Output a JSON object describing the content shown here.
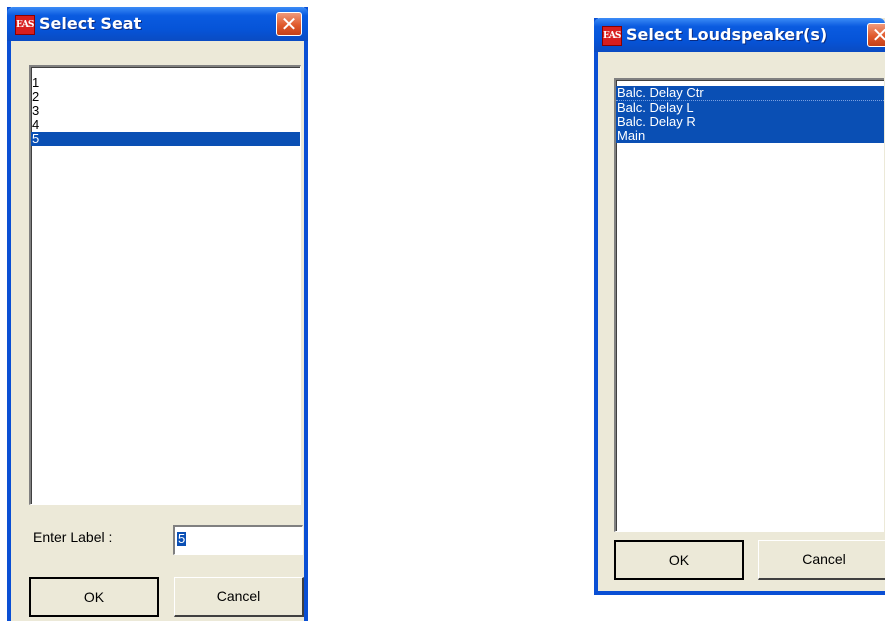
{
  "seat_dialog": {
    "title": "Select Seat",
    "icon_text": "EASE",
    "close_glyph": "✕",
    "items": [
      "1",
      "2",
      "3",
      "4",
      "5"
    ],
    "selected_item": "5",
    "label_prompt": "Enter Label :",
    "label_value": "5",
    "ok_label": "OK",
    "cancel_label": "Cancel"
  },
  "speaker_dialog": {
    "title": "Select Loudspeaker(s)",
    "icon_text": "EASE",
    "close_glyph": "✕",
    "items": [
      "Balc. Delay Ctr",
      "Balc. Delay L",
      "Balc. Delay R",
      "Main"
    ],
    "selected_items": [
      "Balc. Delay Ctr",
      "Balc. Delay L",
      "Balc. Delay R",
      "Main"
    ],
    "ok_label": "OK",
    "cancel_label": "Cancel"
  },
  "colors": {
    "title_bar_blue": "#0654d8",
    "selection_blue": "#0a4fb4",
    "close_button_red": "#e05a2c",
    "dialog_face": "#ece9d8"
  }
}
